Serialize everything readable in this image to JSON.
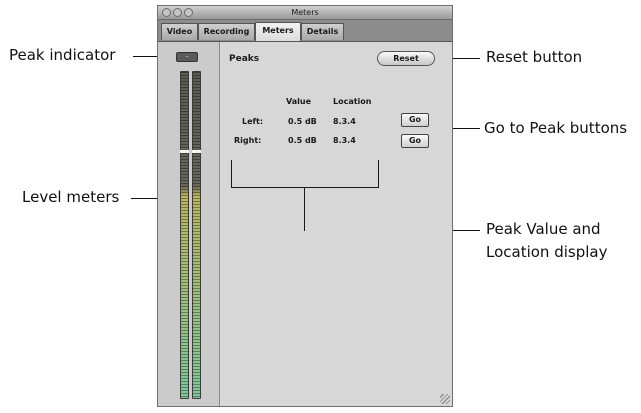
{
  "window": {
    "title": "Meters",
    "tabs": [
      {
        "label": "Video",
        "active": false
      },
      {
        "label": "Recording",
        "active": false
      },
      {
        "label": "Meters",
        "active": true
      },
      {
        "label": "Details",
        "active": false
      }
    ]
  },
  "meters": {
    "peak_indicator_glyph": "–"
  },
  "peaks": {
    "section_label": "Peaks",
    "reset_label": "Reset",
    "columns": {
      "value": "Value",
      "location": "Location"
    },
    "rows": [
      {
        "channel": "Left:",
        "value": "0.5 dB",
        "location": "8.3.4",
        "go_label": "Go"
      },
      {
        "channel": "Right:",
        "value": "0.5 dB",
        "location": "8.3.4",
        "go_label": "Go"
      }
    ]
  },
  "callouts": {
    "peak_indicator": "Peak indicator",
    "level_meters": "Level meters",
    "reset_button": "Reset button",
    "go_to_peak_buttons": "Go to Peak buttons",
    "peak_value_line1": "Peak Value and",
    "peak_value_line2": "Location display"
  },
  "colors": {
    "window_background": "#d7d7d7",
    "meter_upper": "#5c5a52",
    "meter_middle": "#bcb45a",
    "meter_lower": "#7cc89a"
  }
}
